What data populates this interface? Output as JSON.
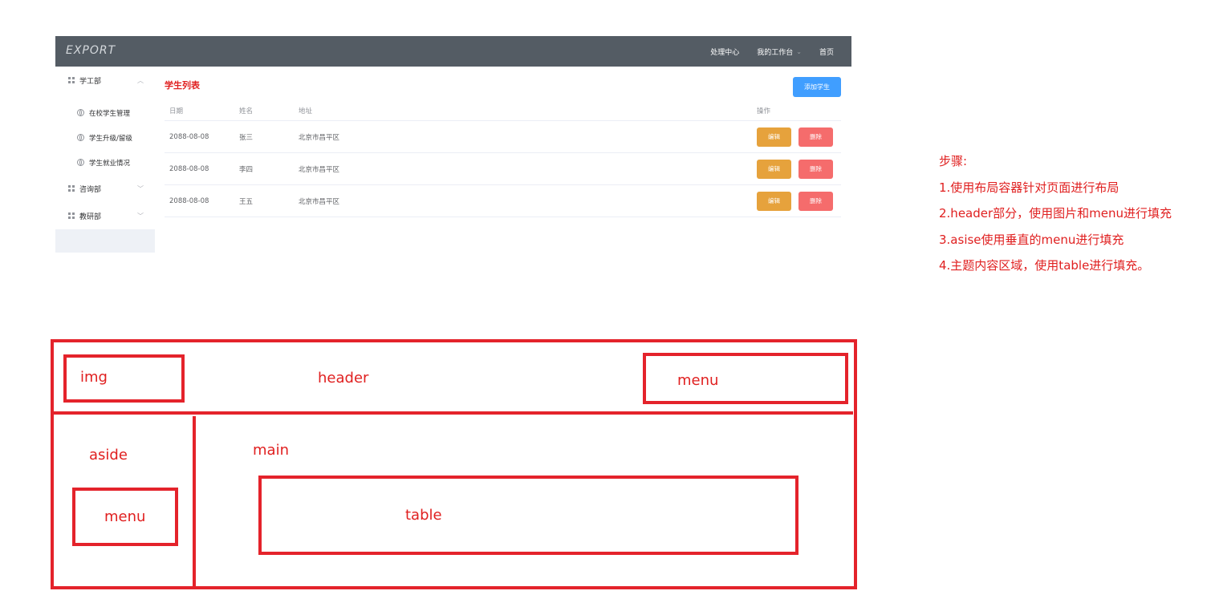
{
  "app": {
    "logo": "EXPORT",
    "top_menu": [
      "处理中心",
      "我的工作台",
      "首页"
    ],
    "aside_menu": [
      {
        "title": "学工部",
        "expanded": true,
        "items": [
          "在校学生管理",
          "学生升级/留级",
          "学生就业情况"
        ]
      },
      {
        "title": "咨询部",
        "expanded": false,
        "items": []
      },
      {
        "title": "教研部",
        "expanded": false,
        "items": []
      }
    ],
    "page_title": "学生列表",
    "add_button": "添加学生",
    "table": {
      "headers": [
        "日期",
        "姓名",
        "地址",
        "操作"
      ],
      "rows": [
        {
          "date": "2088-08-08",
          "name": "张三",
          "address": "北京市昌平区"
        },
        {
          "date": "2088-08-08",
          "name": "李四",
          "address": "北京市昌平区"
        },
        {
          "date": "2088-08-08",
          "name": "王五",
          "address": "北京市昌平区"
        }
      ],
      "edit_label": "编辑",
      "delete_label": "删除"
    },
    "colors": {
      "header_bg": "#545c64",
      "primary": "#409eff",
      "warning": "#e6a23c",
      "danger": "#f56c6c",
      "title": "#e02020"
    },
    "icons": {
      "submenu": "grid-icon",
      "item": "globe-icon",
      "arrow": "chevron-icon"
    }
  },
  "steps": {
    "title": "步骤:",
    "items": [
      "1.使用布局容器针对页面进行布局",
      "2.header部分，使用图片和menu进行填充",
      "3.asise使用垂直的menu进行填充",
      "4.主题内容区域，使用table进行填充。"
    ]
  },
  "diagram": {
    "labels": {
      "img": "img",
      "header": "header",
      "header_menu": "menu",
      "aside": "aside",
      "aside_menu": "menu",
      "main": "main",
      "table": "table"
    },
    "color": "#e4232b"
  }
}
